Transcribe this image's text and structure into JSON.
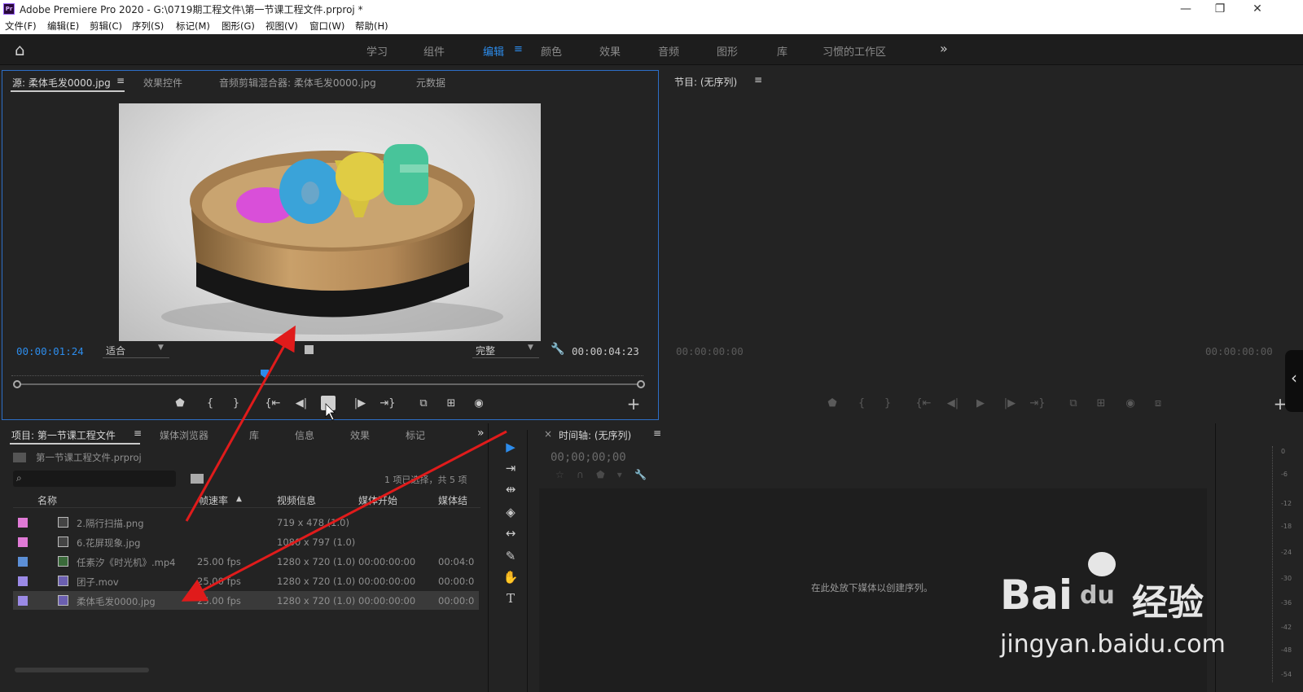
{
  "window": {
    "logo": "Pr",
    "title": "Adobe Premiere Pro 2020 - G:\\0719期工程文件\\第一节课工程文件.prproj *",
    "minimize": "—",
    "restore": "❐",
    "close": "✕"
  },
  "menu": [
    "文件(F)",
    "编辑(E)",
    "剪辑(C)",
    "序列(S)",
    "标记(M)",
    "图形(G)",
    "视图(V)",
    "窗口(W)",
    "帮助(H)"
  ],
  "workspaces": {
    "home": "⌂",
    "items": [
      "学习",
      "组件",
      "编辑",
      "颜色",
      "效果",
      "音频",
      "图形",
      "库",
      "习惯的工作区"
    ],
    "active_menu": "≡",
    "more": "»"
  },
  "source": {
    "tabs": [
      "源: 柔体毛发0000.jpg",
      "效果控件",
      "音频剪辑混合器: 柔体毛发0000.jpg",
      "元数据"
    ],
    "tab_menu": "≡",
    "timecode": "00:00:01:24",
    "fit": "适合",
    "quality": "完整",
    "duration": "00:00:04:23",
    "add": "+"
  },
  "program": {
    "title": "节目: (无序列)",
    "menu": "≡",
    "timecode_left": "00:00:00:00",
    "timecode_right": "00:00:00:00",
    "add": "+",
    "collapse": "‹"
  },
  "project": {
    "tabs": [
      "项目: 第一节课工程文件",
      "媒体浏览器",
      "库",
      "信息",
      "效果",
      "标记"
    ],
    "tab_menu": "≡",
    "more": "»",
    "file": "第一节课工程文件.prproj",
    "status": "1 项已选择，共 5 项",
    "search_icon": "⌕",
    "columns": [
      "名称",
      "帧速率",
      "视频信息",
      "媒体开始",
      "媒体结"
    ],
    "sort": "▲",
    "rows": [
      {
        "color": "#e07ad6",
        "name": "2.隔行扫描.png",
        "fps": "",
        "info": "719 x 478 (1.0)",
        "start": "",
        "end": ""
      },
      {
        "color": "#e07ad6",
        "name": "6.花屏现象.jpg",
        "fps": "",
        "info": "1080 x 797 (1.0)",
        "start": "",
        "end": ""
      },
      {
        "color": "#5c8fd6",
        "name": "任素汐《时光机》.mp4",
        "fps": "25.00 fps",
        "info": "1280 x 720 (1.0)",
        "start": "00:00:00:00",
        "end": "00:04:0"
      },
      {
        "color": "#9b8ae6",
        "name": "团子.mov",
        "fps": "25.00 fps",
        "info": "1280 x 720 (1.0)",
        "start": "00:00:00:00",
        "end": "00:00:0"
      },
      {
        "color": "#9b8ae6",
        "name": "柔体毛发0000.jpg",
        "fps": "25.00 fps",
        "info": "1280 x 720 (1.0)",
        "start": "00:00:00:00",
        "end": "00:00:0"
      }
    ]
  },
  "tools": [
    "▶",
    "⇥",
    "⇹",
    "◈",
    "↔",
    "✎",
    "✋",
    "T"
  ],
  "timeline": {
    "close": "×",
    "title": "时间轴: (无序列)",
    "menu": "≡",
    "timecode": "00;00;00;00",
    "hint": "在此处放下媒体以创建序列。"
  },
  "meter": [
    "0",
    "-6",
    "-12",
    "-18",
    "-24",
    "-30",
    "-36",
    "-42",
    "-48",
    "-54"
  ],
  "watermark": {
    "logo": "Bai",
    "mark": "du",
    "suffix": "经验",
    "url": "jingyan.baidu.com"
  },
  "colors": {
    "accent": "#2d8ceb",
    "arrow": "#e01b1b",
    "panel": "#232323"
  }
}
